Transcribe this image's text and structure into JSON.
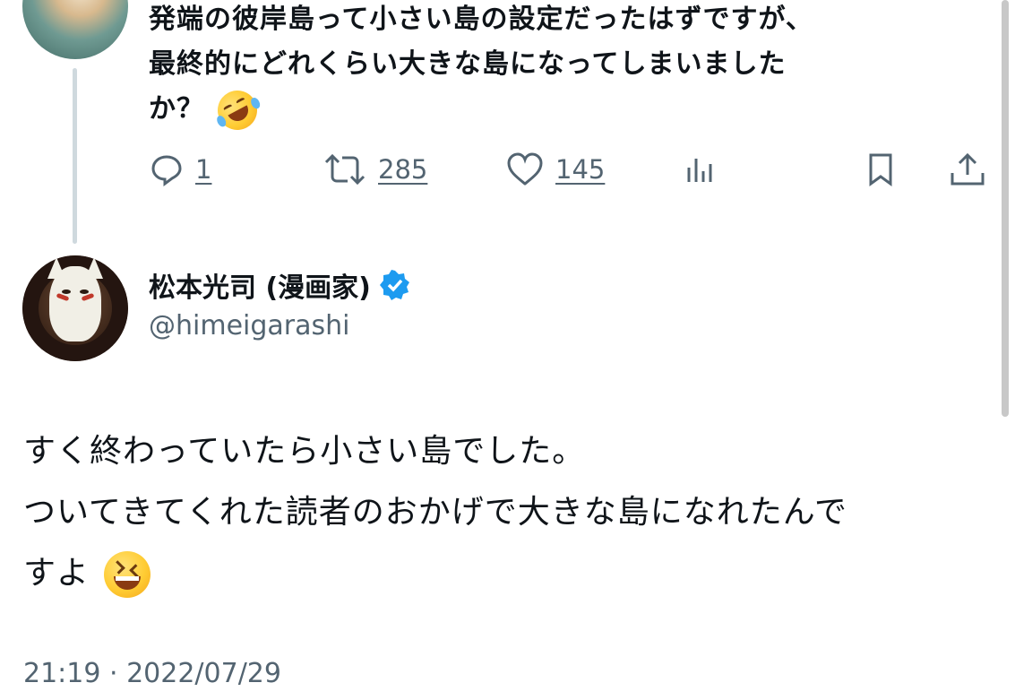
{
  "parent_tweet": {
    "lines": [
      "発端の彼岸島って小さい島の設定だったはずですが、",
      "最終的にどれくらい大きな島になってしまいました",
      "か？"
    ],
    "emoji": "rolling-on-the-floor-laughing",
    "actions": {
      "reply_count": "1",
      "retweet_count": "285",
      "like_count": "145"
    }
  },
  "main_tweet": {
    "display_name": "松本光司 (漫画家)",
    "handle": "@himeigarashi",
    "verified": true,
    "lines": [
      "すく終わっていたら小さい島でした。",
      "ついてきてくれた読者のおかげで大きな島になれたんで",
      "すよ"
    ],
    "emoji": "grinning-squinting-face",
    "timestamp": "21:19 · 2022/07/29"
  },
  "colors": {
    "text": "#0f1419",
    "secondary": "#536471",
    "verified": "#1d9bf0",
    "thread_line": "#cfd9de"
  }
}
